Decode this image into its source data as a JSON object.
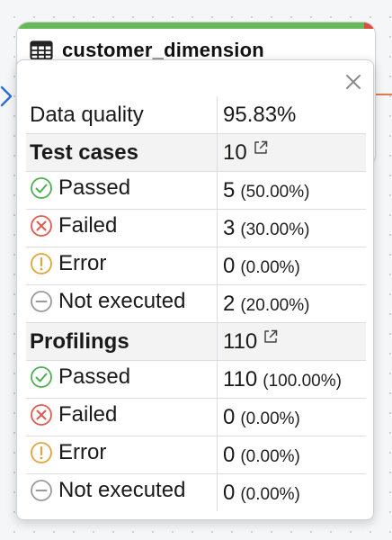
{
  "node": {
    "title": "customer_dimension",
    "icon": "table-icon",
    "status_bar_color": "#66b959",
    "status_bar_error_color": "#e14b3b"
  },
  "popover": {
    "close_icon": "close-icon",
    "data_quality": {
      "label": "Data quality",
      "value": "95.83%"
    },
    "test_cases": {
      "label": "Test cases",
      "value": "10",
      "link_icon": "external-link-icon",
      "rows": [
        {
          "icon": "check-circle-icon",
          "label": "Passed",
          "count": "5",
          "pct": "(50.00%)"
        },
        {
          "icon": "x-circle-icon",
          "label": "Failed",
          "count": "3",
          "pct": "(30.00%)"
        },
        {
          "icon": "exclamation-circle-icon",
          "label": "Error",
          "count": "0",
          "pct": "(0.00%)"
        },
        {
          "icon": "minus-circle-icon",
          "label": "Not executed",
          "count": "2",
          "pct": "(20.00%)"
        }
      ]
    },
    "profilings": {
      "label": "Profilings",
      "value": "110",
      "link_icon": "external-link-icon",
      "rows": [
        {
          "icon": "check-circle-icon",
          "label": "Passed",
          "count": "110",
          "pct": "(100.00%)"
        },
        {
          "icon": "x-circle-icon",
          "label": "Failed",
          "count": "0",
          "pct": "(0.00%)"
        },
        {
          "icon": "exclamation-circle-icon",
          "label": "Error",
          "count": "0",
          "pct": "(0.00%)"
        },
        {
          "icon": "minus-circle-icon",
          "label": "Not executed",
          "count": "0",
          "pct": "(0.00%)"
        }
      ]
    }
  },
  "colors": {
    "passed": "#4caf50",
    "failed": "#e05a4f",
    "error": "#e0a53a",
    "not_executed": "#9a9a9a",
    "edge_in": "#2f6bd9",
    "edge_out": "#e27a4a"
  }
}
